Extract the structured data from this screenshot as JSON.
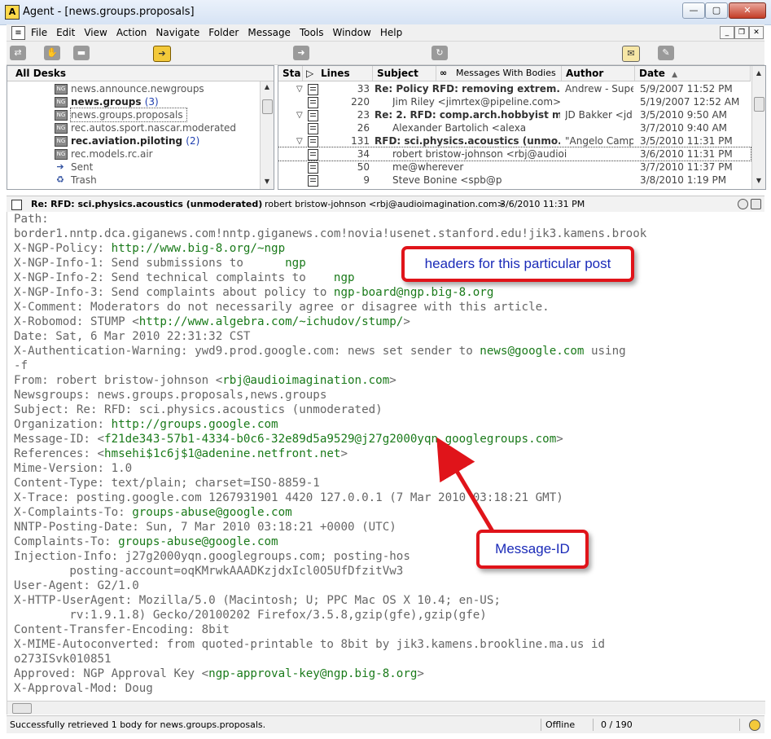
{
  "window": {
    "title": "Agent - [news.groups.proposals]",
    "app_icon": "agent-app-icon"
  },
  "menu": [
    "File",
    "Edit",
    "View",
    "Action",
    "Navigate",
    "Folder",
    "Message",
    "Tools",
    "Window",
    "Help"
  ],
  "folders": {
    "header": "All Desks",
    "items": [
      {
        "name": "news.announce.newgroups",
        "count": "",
        "bold": false,
        "selected": false,
        "icon": "newsgroup-icon"
      },
      {
        "name": "news.groups",
        "count": "(3)",
        "bold": true,
        "selected": false,
        "icon": "newsgroup-icon"
      },
      {
        "name": "news.groups.proposals",
        "count": "",
        "bold": false,
        "selected": true,
        "icon": "newsgroup-icon"
      },
      {
        "name": "rec.autos.sport.nascar.moderated",
        "count": "",
        "bold": false,
        "selected": false,
        "icon": "newsgroup-icon"
      },
      {
        "name": "rec.aviation.piloting",
        "count": "(2)",
        "bold": true,
        "selected": false,
        "icon": "newsgroup-icon"
      },
      {
        "name": "rec.models.rc.air",
        "count": "",
        "bold": false,
        "selected": false,
        "icon": "newsgroup-icon"
      },
      {
        "name": "Sent",
        "count": "",
        "bold": false,
        "selected": false,
        "icon": "sent-icon"
      },
      {
        "name": "Trash",
        "count": "",
        "bold": false,
        "selected": false,
        "icon": "trash-icon"
      }
    ]
  },
  "messages": {
    "columns": {
      "status": "Sta",
      "lines": "Lines",
      "subject": "Subject",
      "bodies": "Messages With Bodies",
      "author": "Author",
      "date": "Date"
    },
    "rows": [
      {
        "lines": "33",
        "subject": "Re: Policy RFD: removing extrem...",
        "author": "Andrew - Supe",
        "date": "5/9/2007 11:52 PM",
        "bold": true,
        "thread": true,
        "selected": false
      },
      {
        "lines": "220",
        "subject": "Jim Riley <jimrtex@pipeline.com>",
        "author": "",
        "date": "5/19/2007 12:52 AM",
        "bold": false,
        "thread": false,
        "selected": false
      },
      {
        "lines": "23",
        "subject": "Re: 2. RFD: comp.arch.hobbyist m...",
        "author": "JD Bakker <jd",
        "date": "3/5/2010 9:50 AM",
        "bold": true,
        "thread": true,
        "selected": false
      },
      {
        "lines": "26",
        "subject": "Alexander Bartolich <alexa",
        "author": "",
        "date": "3/7/2010 9:40 AM",
        "bold": false,
        "thread": false,
        "selected": false
      },
      {
        "lines": "131",
        "subject": "RFD: sci.physics.acoustics (unmo...",
        "author": "\"Angelo Camp",
        "date": "3/5/2010 11:31 PM",
        "bold": true,
        "thread": true,
        "selected": false
      },
      {
        "lines": "34",
        "subject": "robert bristow-johnson <rbj@audioi",
        "author": "",
        "date": "3/6/2010 11:31 PM",
        "bold": false,
        "thread": false,
        "selected": true
      },
      {
        "lines": "50",
        "subject": "me@wherever",
        "author": "",
        "date": "3/7/2010 11:37 PM",
        "bold": false,
        "thread": false,
        "selected": false
      },
      {
        "lines": "9",
        "subject": "Steve Bonine <spb@p",
        "author": "",
        "date": "3/8/2010 1:19 PM",
        "bold": false,
        "thread": false,
        "selected": false
      }
    ]
  },
  "message_bar": {
    "subject": "Re: RFD: sci.physics.acoustics (unmoderated)",
    "from": "robert bristow-johnson <rbj@audioimagination.com>",
    "date": "3/6/2010 11:31 PM"
  },
  "body_lines": [
    {
      "pre": "Path:",
      "link": "",
      "post": ""
    },
    {
      "pre": "border1.nntp.dca.giganews.com!nntp.giganews.com!novia!usenet.stanford.edu!jik3.kamens.brook",
      "link": "",
      "post": ""
    },
    {
      "pre": "X-NGP-Policy: ",
      "link": "http://www.big-8.org/~ngp",
      "post": ""
    },
    {
      "pre": "X-NGP-Info-1: Send submissions to      ",
      "link": "ngp",
      "post": ""
    },
    {
      "pre": "X-NGP-Info-2: Send technical complaints to    ",
      "link": "ngp",
      "post": ""
    },
    {
      "pre": "X-NGP-Info-3: Send complaints about policy to ",
      "link": "ngp-board@ngp.big-8.org",
      "post": ""
    },
    {
      "pre": "X-Comment: Moderators do not necessarily agree or disagree with this article.",
      "link": "",
      "post": ""
    },
    {
      "pre": "X-Robomod: STUMP <",
      "link": "http://www.algebra.com/~ichudov/stump/",
      "post": ">"
    },
    {
      "pre": "Date: Sat, 6 Mar 2010 22:31:32 CST",
      "link": "",
      "post": ""
    },
    {
      "pre": "X-Authentication-Warning: ywd9.prod.google.com: news set sender to ",
      "link": "news@google.com",
      "post": " using"
    },
    {
      "pre": "-f",
      "link": "",
      "post": ""
    },
    {
      "pre": "From: robert bristow-johnson <",
      "link": "rbj@audioimagination.com",
      "post": ">"
    },
    {
      "pre": "Newsgroups: news.groups.proposals,news.groups",
      "link": "",
      "post": ""
    },
    {
      "pre": "Subject: Re: RFD: sci.physics.acoustics (unmoderated)",
      "link": "",
      "post": ""
    },
    {
      "pre": "Organization: ",
      "link": "http://groups.google.com",
      "post": ""
    },
    {
      "pre": "Message-ID: <",
      "link": "f21de343-57b1-4334-b0c6-32e89d5a9529@j27g2000yqn.googlegroups.com",
      "post": ">"
    },
    {
      "pre": "References: <",
      "link": "hmsehi$1c6j$1@adenine.netfront.net",
      "post": ">"
    },
    {
      "pre": "Mime-Version: 1.0",
      "link": "",
      "post": ""
    },
    {
      "pre": "Content-Type: text/plain; charset=ISO-8859-1",
      "link": "",
      "post": ""
    },
    {
      "pre": "X-Trace: posting.google.com 1267931901 4420 127.0.0.1 (7 Mar 2010 03:18:21 GMT)",
      "link": "",
      "post": ""
    },
    {
      "pre": "X-Complaints-To: ",
      "link": "groups-abuse@google.com",
      "post": ""
    },
    {
      "pre": "NNTP-Posting-Date: Sun, 7 Mar 2010 03:18:21 +0000 (UTC)",
      "link": "",
      "post": ""
    },
    {
      "pre": "Complaints-To: ",
      "link": "groups-abuse@google.com",
      "post": ""
    },
    {
      "pre": "Injection-Info: j27g2000yqn.googlegroups.com; posting-hos",
      "link": "",
      "post": ""
    },
    {
      "pre": "        posting-account=oqKMrwkAAADKzjdxIcl0O5UfDfzitVw3",
      "link": "",
      "post": ""
    },
    {
      "pre": "User-Agent: G2/1.0",
      "link": "",
      "post": ""
    },
    {
      "pre": "X-HTTP-UserAgent: Mozilla/5.0 (Macintosh; U; PPC Mac OS X 10.4; en-US;",
      "link": "",
      "post": ""
    },
    {
      "pre": "        rv:1.9.1.8) Gecko/20100202 Firefox/3.5.8,gzip(gfe),gzip(gfe)",
      "link": "",
      "post": ""
    },
    {
      "pre": "Content-Transfer-Encoding: 8bit",
      "link": "",
      "post": ""
    },
    {
      "pre": "X-MIME-Autoconverted: from quoted-printable to 8bit by jik3.kamens.brookline.ma.us id",
      "link": "",
      "post": ""
    },
    {
      "pre": "o273ISvk010851",
      "link": "",
      "post": ""
    },
    {
      "pre": "Approved: NGP Approval Key <",
      "link": "ngp-approval-key@ngp.big-8.org",
      "post": ">"
    },
    {
      "pre": "X-Approval-Mod: Doug",
      "link": "",
      "post": ""
    }
  ],
  "callouts": {
    "headers": "headers for this particular post",
    "message_id": "Message-ID"
  },
  "status": {
    "text": "Successfully retrieved 1 body for news.groups.proposals.",
    "mode": "Offline",
    "count": "0 / 190"
  },
  "colors": {
    "link": "#1a7a1a",
    "callout_border": "#e0141a",
    "callout_text": "#1a2ab8",
    "unread_count": "#2040b0"
  }
}
